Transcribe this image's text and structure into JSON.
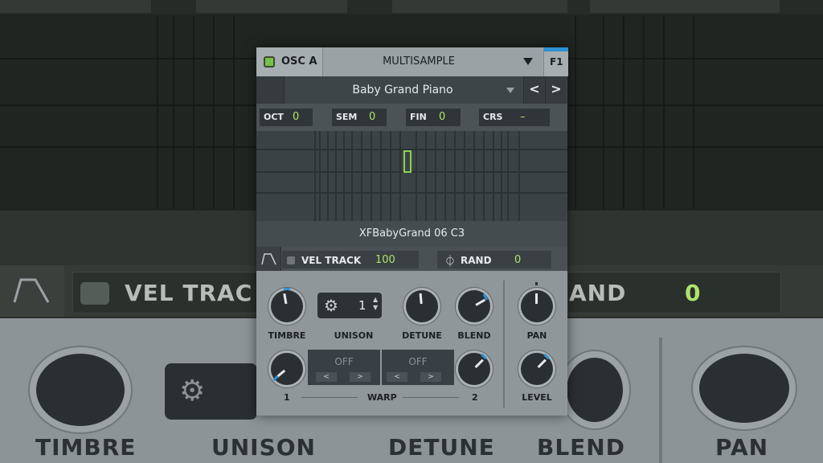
{
  "background": {
    "vel_track_label": "VEL TRAC",
    "rand_label": "AND",
    "rand_value": "0",
    "labels": [
      "TIMBRE",
      "UNISON",
      "DETUNE",
      "BLEND",
      "PAN"
    ]
  },
  "osc": {
    "name": "OSC A",
    "type": "MULTISAMPLE",
    "f1": "F1",
    "enabled_color": "#74c24a",
    "accent": "#2e91d2",
    "value_color": "#aee36b"
  },
  "preset": {
    "name": "Baby Grand Piano",
    "prev": "<",
    "next": ">"
  },
  "params": [
    {
      "label": "OCT",
      "value": "0"
    },
    {
      "label": "SEM",
      "value": "0"
    },
    {
      "label": "FIN",
      "value": "0"
    },
    {
      "label": "CRS",
      "value": "–"
    }
  ],
  "sample": {
    "name": "XFBabyGrand 06 C3"
  },
  "vel_track": {
    "label": "VEL TRACK",
    "value": "100"
  },
  "rand": {
    "icon": "phase-icon",
    "label": "RAND",
    "value": "0"
  },
  "controls": {
    "timbre": "TIMBRE",
    "unison": "UNISON",
    "unison_value": "1",
    "detune": "DETUNE",
    "blend": "BLEND",
    "pan": "PAN",
    "level": "LEVEL",
    "warp": "WARP",
    "warp1_label": "1",
    "warp2_label": "2",
    "warp1_value": "OFF",
    "warp2_value": "OFF",
    "arrow_left": "<",
    "arrow_right": ">"
  }
}
